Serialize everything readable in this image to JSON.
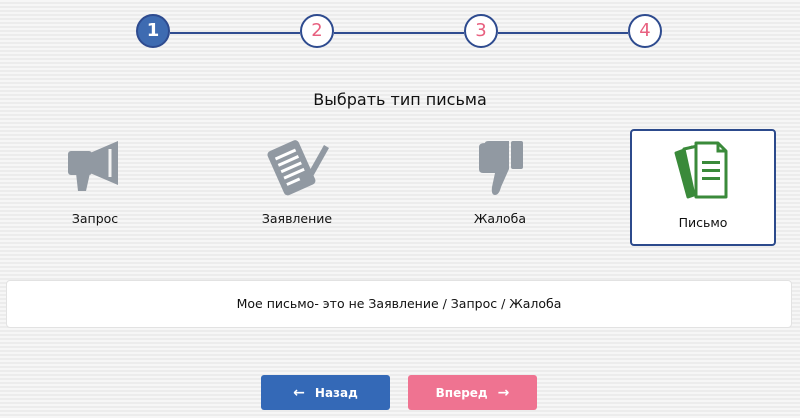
{
  "stepper": {
    "steps": [
      {
        "label": "1",
        "active": true
      },
      {
        "label": "2",
        "active": false
      },
      {
        "label": "3",
        "active": false
      },
      {
        "label": "4",
        "active": false
      }
    ]
  },
  "section_title": "Выбрать тип письма",
  "options": [
    {
      "label": "Запрос",
      "icon": "megaphone-icon",
      "selected": false
    },
    {
      "label": "Заявление",
      "icon": "document-pen-icon",
      "selected": false
    },
    {
      "label": "Жалоба",
      "icon": "thumbs-down-icon",
      "selected": false
    },
    {
      "label": "Письмо",
      "icon": "documents-icon",
      "selected": true
    }
  ],
  "description": "Мое письмо- это не Заявление / Запрос / Жалоба",
  "buttons": {
    "back_label": "Назад",
    "back_icon": "arrow-left-icon",
    "next_label": "Вперед",
    "next_icon": "arrow-right-icon"
  },
  "colors": {
    "primary": "#3469b7",
    "accent": "#ef7391",
    "step_border": "#2e4b8f",
    "icon_gray": "#9199a2",
    "icon_green": "#3a8a3a"
  }
}
